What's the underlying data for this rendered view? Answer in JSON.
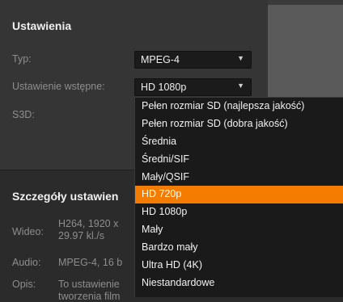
{
  "settings": {
    "title": "Ustawienia",
    "type_label": "Typ:",
    "type_value": "MPEG-4",
    "preset_label": "Ustawienie wstępne:",
    "preset_value": "HD 1080p",
    "s3d_label": "S3D:"
  },
  "details": {
    "title": "Szczegóły ustawien",
    "video_label": "Wideo:",
    "video_line1": "H264, 1920 x",
    "video_line2": "29.97 kl./s",
    "audio_label": "Audio:",
    "audio_value": "MPEG-4, 16 b",
    "desc_label": "Opis:",
    "desc_line1": "To ustawienie",
    "desc_line2": "tworzenia film"
  },
  "preset_menu": {
    "selected_index": 5,
    "items": [
      "Pełen rozmiar SD (najlepsza jakość)",
      "Pełen rozmiar SD (dobra jakość)",
      "Średnia",
      "Średni/SIF",
      "Mały/QSIF",
      "HD 720p",
      "HD 1080p",
      "Mały",
      "Bardzo mały",
      "Ultra HD (4K)",
      "Niestandardowe"
    ]
  },
  "colors": {
    "accent": "#f47c00",
    "panel": "#353535",
    "menu_bg": "#1a1a1a"
  },
  "icons": {
    "dropdown_arrow": "triangle-down-icon"
  }
}
